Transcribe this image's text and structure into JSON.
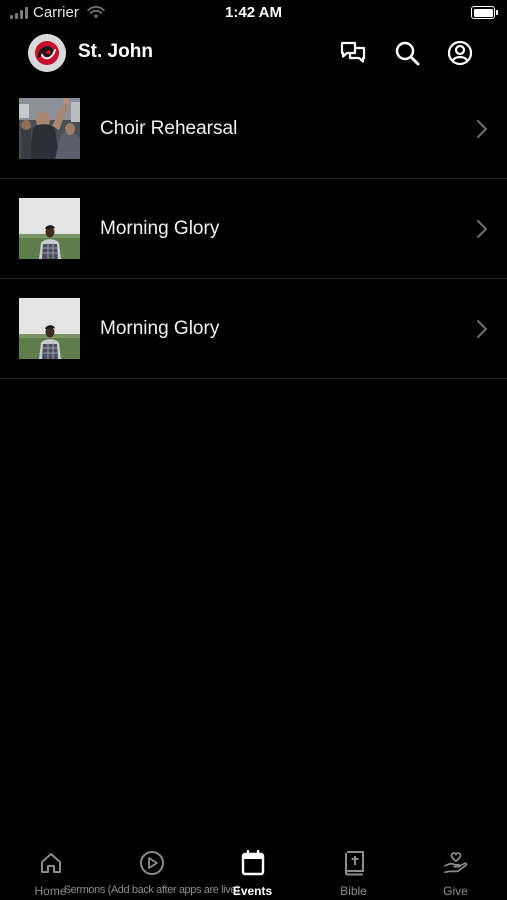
{
  "status_bar": {
    "carrier": "Carrier",
    "time": "1:42 AM",
    "icons": [
      "signal-icon",
      "wifi-icon",
      "battery-icon"
    ]
  },
  "header": {
    "church_name": "St. John",
    "logo_icon": "church-logo",
    "actions": [
      "chat-icon",
      "search-icon",
      "profile-icon"
    ]
  },
  "events": [
    {
      "title": "Choir Rehearsal",
      "thumbnail": "choir-photo"
    },
    {
      "title": "Morning Glory",
      "thumbnail": "person-in-field-photo"
    },
    {
      "title": "Morning Glory",
      "thumbnail": "person-in-field-photo"
    }
  ],
  "tab_bar": {
    "tabs": [
      {
        "label": "Home",
        "icon": "home-icon",
        "active": false
      },
      {
        "label": "Sermons (Add back after apps are live)",
        "icon": "play-icon",
        "active": false
      },
      {
        "label": "Events",
        "icon": "calendar-icon",
        "active": true
      },
      {
        "label": "Bible",
        "icon": "bible-icon",
        "active": false
      },
      {
        "label": "Give",
        "icon": "give-icon",
        "active": false
      }
    ]
  },
  "colors": {
    "background": "#000000",
    "text": "#ffffff",
    "inactive_tab": "#8c8c8c",
    "divider": "#2a2a2a",
    "logo_accent": "#c8102e"
  }
}
